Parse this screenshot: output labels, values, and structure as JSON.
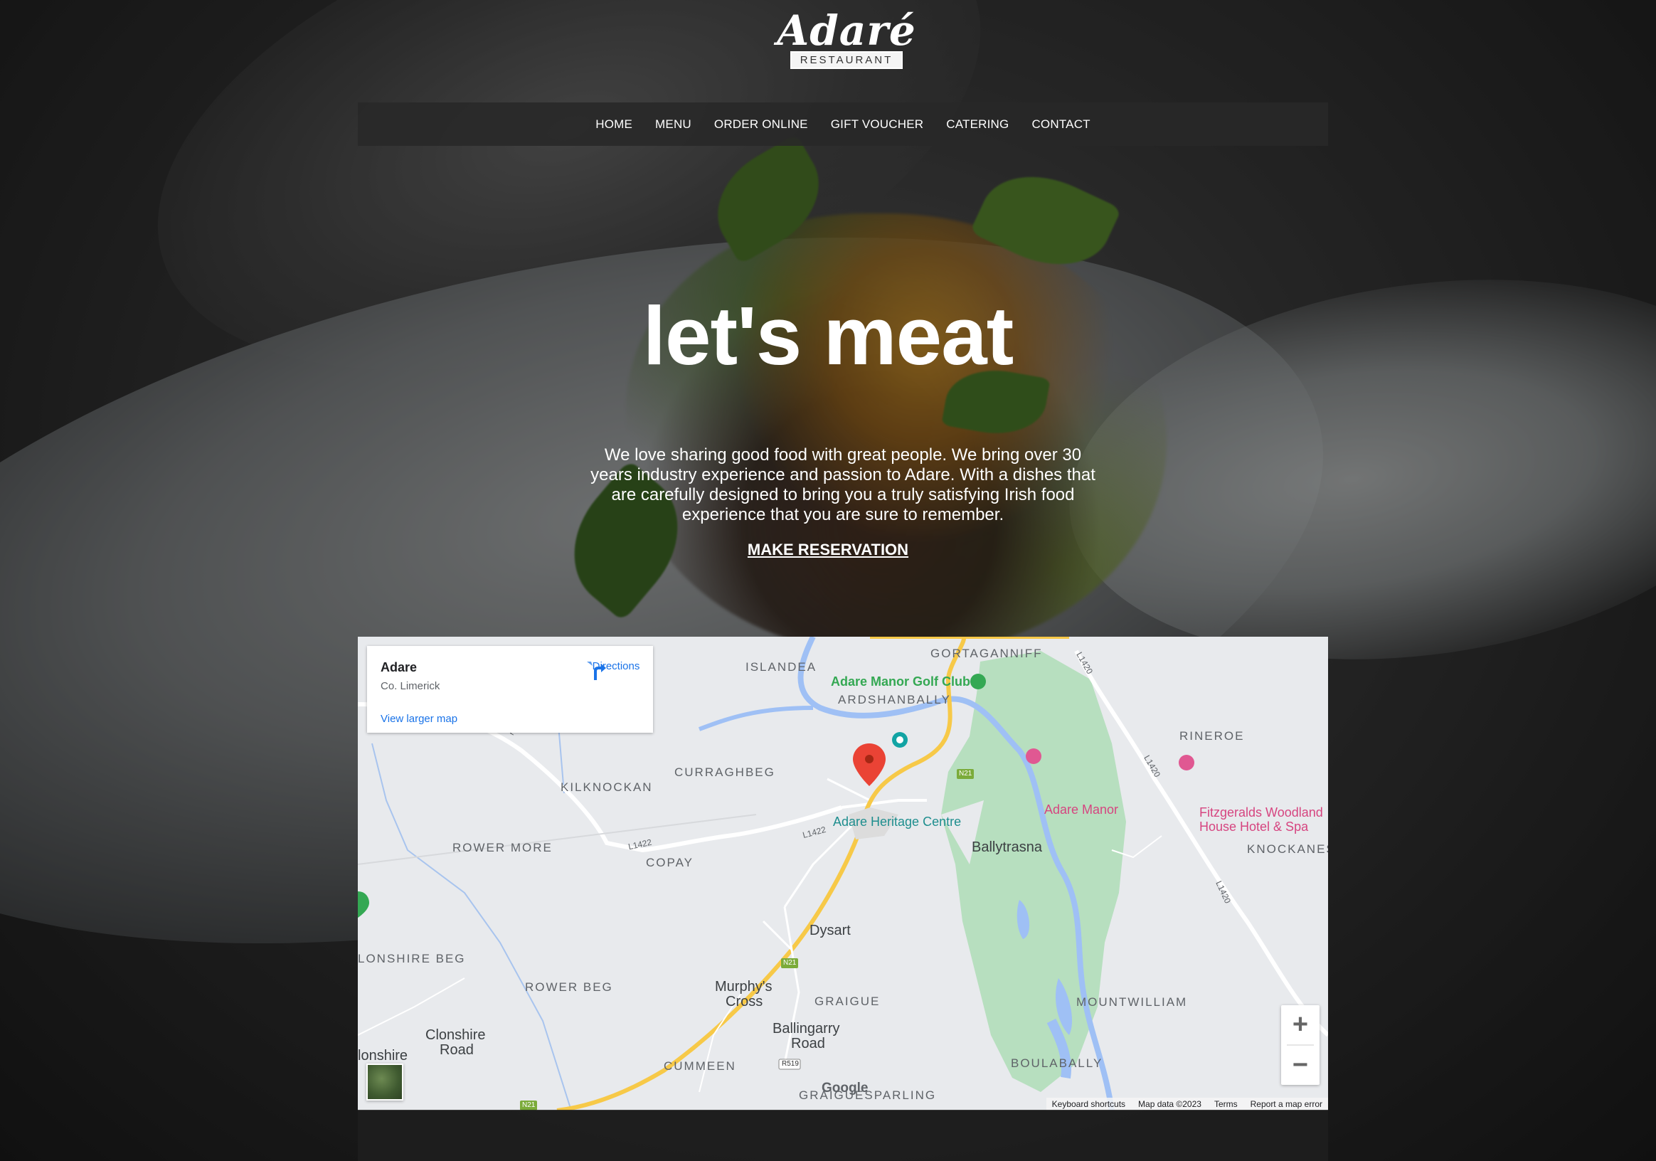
{
  "brand": {
    "script": "Adaré",
    "sub": "RESTAURANT"
  },
  "nav": {
    "items": [
      {
        "label": "HOME"
      },
      {
        "label": "MENU"
      },
      {
        "label": "ORDER ONLINE"
      },
      {
        "label": "GIFT VOUCHER"
      },
      {
        "label": "CATERING"
      },
      {
        "label": "CONTACT"
      }
    ]
  },
  "hero": {
    "title": "let's meat",
    "text": "We love sharing good food with great people. We bring over 30 years industry experience and passion to Adare. With a dishes that are carefully designed to bring you a truly satisfying Irish food experience that you are sure to remember.",
    "cta": "MAKE RESERVATION"
  },
  "map": {
    "card": {
      "title": "Adare",
      "subtitle": "Co. Limerick",
      "directions": "Directions",
      "larger_map": "View larger map"
    },
    "labels": {
      "islandea": "ISLANDEA",
      "gortaganniff": "GORTAGANNIFF",
      "golf": "Adare Manor Golf Club",
      "ardshanbally": "ARDSHANBALLY",
      "rineroe": "RINEROE",
      "curraghbeg": "CURRAGHBEG",
      "kilknockan": "KILKNOCKAN",
      "heritage": "Adare Heritage Centre",
      "adare_manor": "Adare Manor",
      "fitzgeralds1": "Fitzgeralds Woodland",
      "fitzgeralds2": "House Hotel & Spa",
      "knockanes": "KNOCKANES",
      "rower_more": "ROWER MORE",
      "copay": "COPAY",
      "ballytrasna": "Ballytrasna",
      "dysart": "Dysart",
      "clonshire_beg": "LONSHIRE BEG",
      "rower_beg": "ROWER BEG",
      "murphys1": "Murphy's",
      "murphys2": "Cross",
      "graigue": "GRAIGUE",
      "mountwilliam": "MOUNTWILLIAM",
      "clonshire_road1": "Clonshire",
      "clonshire_road2": "Road",
      "lonshire": "lonshire",
      "ballingarry1": "Ballingarry",
      "ballingarry2": "Road",
      "cummeen": "CUMMEEN",
      "boulabally": "BOULABALLY",
      "graiguesparling": "GRAIGUESPARLING",
      "road_l1422a": "L1422",
      "road_l1422b": "L1422",
      "road_l1422c": "L1422",
      "road_l1420a": "L1420",
      "road_l1420b": "L1420",
      "road_l1420c": "L1420",
      "road_n21a": "N21",
      "road_n21b": "N21",
      "road_n21c": "N21",
      "road_r519": "R519"
    },
    "zoom_in": "+",
    "zoom_out": "−",
    "google": "Google",
    "attribution": {
      "shortcuts": "Keyboard shortcuts",
      "data": "Map data ©2023",
      "terms": "Terms",
      "report": "Report a map error"
    }
  },
  "colors": {
    "nav_bg": "#282828",
    "link_blue": "#1a73e8",
    "park_green": "#b7dfbf",
    "road_yellow": "#f7c948",
    "water_blue": "#9fc0f5",
    "marker_red": "#ea4335"
  }
}
